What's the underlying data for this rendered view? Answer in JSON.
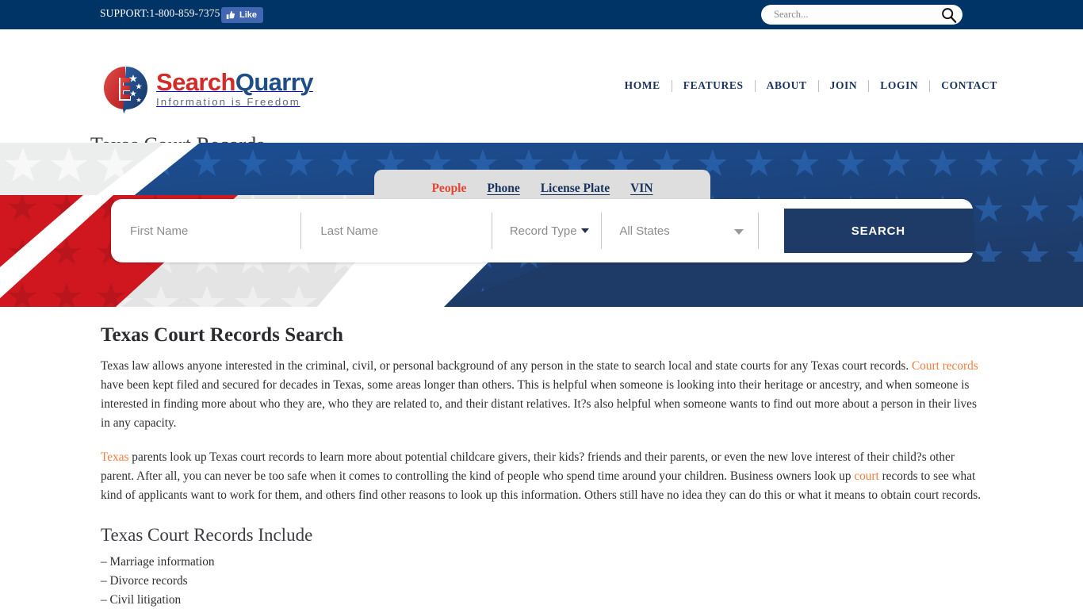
{
  "topbar": {
    "support": "SUPPORT:1-800-859-7375",
    "like_label": "Like",
    "like_icon": "thumbs-up-icon",
    "search_placeholder": "Search...",
    "search_value": "",
    "search_icon": "magnifier-icon",
    "bg_color": "#003366"
  },
  "header": {
    "logo": {
      "word1": "Search",
      "word2": "Quarry",
      "tagline": "Information is Freedom",
      "word1_color": "#d32b28",
      "word2_color": "#1f4e87",
      "mark_icon": "searchquarry-shield-logo"
    },
    "nav": [
      {
        "label": "HOME"
      },
      {
        "label": "FEATURES"
      },
      {
        "label": "ABOUT"
      },
      {
        "label": "JOIN"
      },
      {
        "label": "LOGIN"
      },
      {
        "label": "CONTACT"
      }
    ],
    "page_title": "Texas Court Records"
  },
  "hero": {
    "bg_color": "#1e3a66",
    "tabs": [
      {
        "label": "People",
        "active": true
      },
      {
        "label": "Phone",
        "active": false
      },
      {
        "label": "License Plate",
        "active": false
      },
      {
        "label": "VIN",
        "active": false
      }
    ],
    "active_tab_color": "#e2452f",
    "form": {
      "first_name_placeholder": "First Name",
      "first_name_value": "",
      "last_name_placeholder": "Last Name",
      "last_name_value": "",
      "record_type_label": "Record Type",
      "state_label": "All States",
      "search_button": "SEARCH",
      "button_color": "#1e3a66"
    }
  },
  "main": {
    "heading": "Texas Court Records Search",
    "paragraph1": {
      "part1": "Texas law allows anyone interested in the criminal, civil, or personal background of any person in the state to search local and state courts for any Texas court records. ",
      "link1": "Court records",
      "part2": " have been kept filed and secured for decades in Texas, some areas longer than others. This is helpful when someone is looking into their heritage or ancestry, and when someone is interested in finding more about who they are, who they are related to, and their distant relatives. It?s also helpful when someone wants to find out more about a person in their lives in any capacity."
    },
    "paragraph2": {
      "link1": "Texas",
      "part1": " parents look up Texas court records to learn more about potential childcare givers, their kids? friends and their parents, or even the new love interest of their child?s other parent. After all, you can never be too safe when it comes to controlling the kind of people who spend time around your children. Business owners look up ",
      "link2": "court",
      "part2": " records to see what kind of applicants want to work for them, and others find other reasons to look up this information. Others still have no idea they can do this or what it means to obtain court records."
    },
    "subheading": "Texas Court Records Include",
    "list": [
      "– Marriage information",
      "– Divorce records",
      "– Civil litigation"
    ],
    "link_color": "#ef7d3c"
  }
}
